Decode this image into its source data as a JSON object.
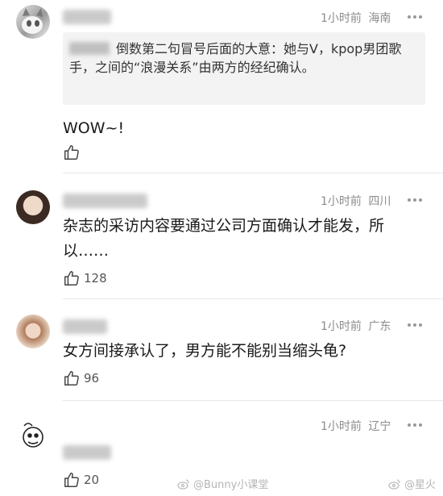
{
  "comments": [
    {
      "time": "1小时前",
      "location": "海南",
      "quote": "倒数第二句冒号后面的大意：她与V，kpop男团歌手，之间的“浪漫关系”由两方的经纪确认。",
      "text": "WOW~!",
      "likes": ""
    },
    {
      "time": "1小时前",
      "location": "四川",
      "text": "杂志的采访内容要通过公司方面确认才能发，所以……",
      "likes": "128"
    },
    {
      "time": "1小时前",
      "location": "广东",
      "text": "女方间接承认了，男方能不能别当缩头龟?",
      "likes": "96"
    },
    {
      "time": "1小时前",
      "location": "辽宁",
      "text": "",
      "likes": "20"
    }
  ],
  "watermark": {
    "left": "@Bunny小课堂",
    "right": "@星火"
  },
  "colors": {
    "meta_text": "#8c8c8c",
    "quote_bg": "#f3f3f3",
    "divider": "#e6e6e6"
  },
  "icons": [
    "like-icon",
    "more-icon",
    "weibo-logo-icon"
  ]
}
